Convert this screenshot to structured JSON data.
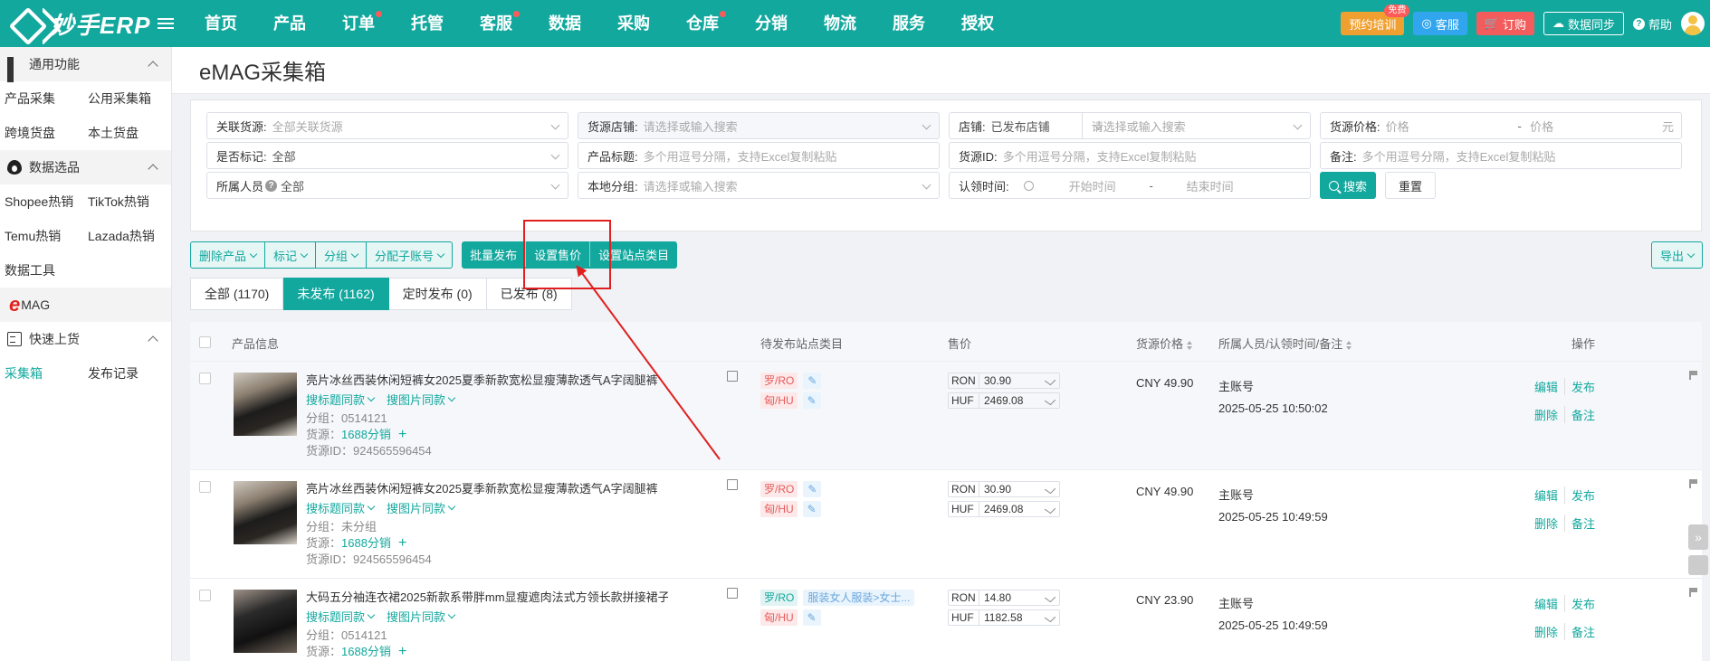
{
  "brand": {
    "name": "妙手ERP"
  },
  "nav": [
    {
      "label": "首页",
      "dot": false
    },
    {
      "label": "产品",
      "dot": false
    },
    {
      "label": "订单",
      "dot": true
    },
    {
      "label": "托管",
      "dot": false
    },
    {
      "label": "客服",
      "dot": true
    },
    {
      "label": "数据",
      "dot": false
    },
    {
      "label": "采购",
      "dot": false
    },
    {
      "label": "仓库",
      "dot": true
    },
    {
      "label": "分销",
      "dot": false
    },
    {
      "label": "物流",
      "dot": false
    },
    {
      "label": "服务",
      "dot": false
    },
    {
      "label": "授权",
      "dot": false
    }
  ],
  "topright": {
    "training": "预约培训",
    "training_badge": "免费",
    "service": "客服",
    "order": "订购",
    "sync": "数据同步",
    "help": "帮助"
  },
  "sidebar": {
    "group1": "通用功能",
    "row1": [
      "产品采集",
      "公用采集箱"
    ],
    "row2": [
      "跨境货盘",
      "本土货盘"
    ],
    "group2": "数据选品",
    "row3": [
      "Shopee热销",
      "TikTok热销"
    ],
    "row4": [
      "Temu热销",
      "Lazada热销"
    ],
    "row5": "数据工具",
    "emag_e": "e",
    "emag": "MAG",
    "group3": "快速上货",
    "row6": [
      "采集箱",
      "发布记录"
    ]
  },
  "page": {
    "title": "eMAG采集箱"
  },
  "filters": {
    "source_link_label": "关联货源:",
    "source_link_ph": "全部关联货源",
    "source_shop_label": "货源店铺:",
    "source_shop_ph": "请选择或输入搜索",
    "shop_label": "店铺:",
    "shop_value": "已发布店铺",
    "shop_search_ph": "请选择或输入搜索",
    "price_label": "货源价格:",
    "price_min_ph": "价格",
    "price_dash": "-",
    "price_max_ph": "价格",
    "price_unit": "元",
    "marked_label": "是否标记:",
    "marked_value": "全部",
    "ptitle_label": "产品标题:",
    "ptitle_ph": "多个用逗号分隔，支持Excel复制粘贴",
    "sid_label": "货源ID:",
    "sid_ph": "多个用逗号分隔，支持Excel复制粘贴",
    "note_label": "备注:",
    "note_ph": "多个用逗号分隔，支持Excel复制粘贴",
    "owner_label": "所属人员",
    "owner_value": "全部",
    "group_label": "本地分组:",
    "group_ph": "请选择或输入搜索",
    "claim_label": "认领时间:",
    "claim_start": "开始时间",
    "claim_dash": "-",
    "claim_end": "结束时间",
    "search": "搜索",
    "reset": "重置"
  },
  "actions": {
    "delete": "删除产品",
    "mark": "标记",
    "group": "分组",
    "assign": "分配子账号",
    "batch_publish": "批量发布",
    "set_price": "设置售价",
    "set_category": "设置站点类目",
    "export": "导出"
  },
  "tabs": [
    "全部 (1170)",
    "未发布 (1162)",
    "定时发布 (0)",
    "已发布 (8)"
  ],
  "table": {
    "headers": {
      "product": "产品信息",
      "category": "待发布站点类目",
      "price": "售价",
      "src_price": "货源价格",
      "owner": "所属人员/认领时间/备注",
      "ops": "操作"
    },
    "rows": [
      {
        "title": "亮片冰丝西装休闲短裤女2025夏季新款宽松显瘦薄款透气A字阔腿裤",
        "link1": "搜标题同款",
        "link2": "搜图片同款",
        "group": "分组：0514121",
        "source_label": "货源：",
        "source": "1688分销",
        "source_id": "货源ID：924565596454",
        "sites": [
          {
            "site": "罗/RO",
            "cat": "",
            "teal": false
          },
          {
            "site": "匈/HU",
            "cat": "",
            "teal": false
          }
        ],
        "prices": [
          {
            "cur": "RON",
            "amt": "30.90"
          },
          {
            "cur": "HUF",
            "amt": "2469.08"
          }
        ],
        "src_price": "CNY 49.90",
        "owner": "主账号",
        "time": "2025-05-25 10:50:02",
        "ops": [
          "编辑",
          "发布",
          "删除",
          "备注"
        ]
      },
      {
        "title": "亮片冰丝西装休闲短裤女2025夏季新款宽松显瘦薄款透气A字阔腿裤",
        "link1": "搜标题同款",
        "link2": "搜图片同款",
        "group": "分组：未分组",
        "source_label": "货源：",
        "source": "1688分销",
        "source_id": "货源ID：924565596454",
        "sites": [
          {
            "site": "罗/RO",
            "cat": "",
            "teal": false
          },
          {
            "site": "匈/HU",
            "cat": "",
            "teal": false
          }
        ],
        "prices": [
          {
            "cur": "RON",
            "amt": "30.90"
          },
          {
            "cur": "HUF",
            "amt": "2469.08"
          }
        ],
        "src_price": "CNY 49.90",
        "owner": "主账号",
        "time": "2025-05-25 10:49:59",
        "ops": [
          "编辑",
          "发布",
          "删除",
          "备注"
        ]
      },
      {
        "title": "大码五分袖连衣裙2025新款系带胖mm显瘦遮肉法式方领长款拼接裙子",
        "link1": "搜标题同款",
        "link2": "搜图片同款",
        "group": "分组：0514121",
        "source_label": "货源：",
        "source": "1688分销",
        "source_id": "",
        "sites": [
          {
            "site": "罗/RO",
            "cat": "服装女人服装>女士...",
            "teal": true
          },
          {
            "site": "匈/HU",
            "cat": "",
            "teal": false
          }
        ],
        "prices": [
          {
            "cur": "RON",
            "amt": "14.80"
          },
          {
            "cur": "HUF",
            "amt": "1182.58"
          }
        ],
        "src_price": "CNY 23.90",
        "owner": "主账号",
        "time": "2025-05-25 10:49:59",
        "ops": [
          "编辑",
          "发布",
          "删除",
          "备注"
        ]
      }
    ]
  },
  "colors": {
    "brand": "#13a89e",
    "annotation": "#e02020"
  },
  "icons": [
    "menu-icon",
    "grid-icon",
    "fire-icon",
    "doc-icon",
    "search-icon",
    "clock-icon",
    "pencil-icon",
    "flag-icon",
    "help-icon",
    "user-avatar-icon"
  ]
}
